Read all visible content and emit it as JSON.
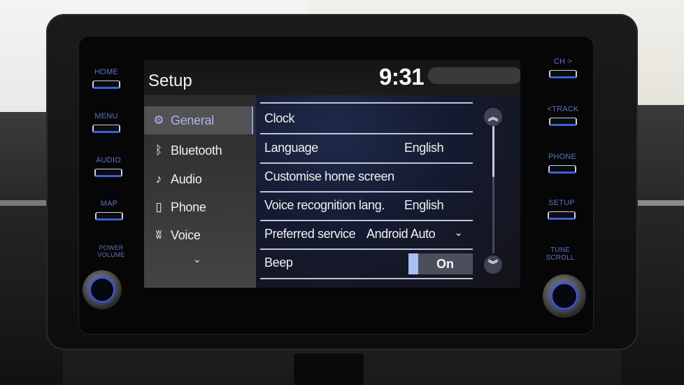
{
  "screen": {
    "title": "Setup",
    "clock": "9:31"
  },
  "hardware_buttons": {
    "left": [
      {
        "label": "HOME"
      },
      {
        "label": "MENU"
      },
      {
        "label": "AUDIO"
      },
      {
        "label": "MAP"
      },
      {
        "label": "POWER VOLUME"
      }
    ],
    "right": [
      {
        "label": "CH >"
      },
      {
        "label": "<TRACK"
      },
      {
        "label": "PHONE"
      },
      {
        "label": "SETUP"
      },
      {
        "label": "TUNE SCROLL"
      }
    ]
  },
  "sidebar": {
    "items": [
      {
        "label": "General",
        "icon": "gear-icon",
        "glyph": "⚙",
        "active": true
      },
      {
        "label": "Bluetooth",
        "icon": "bluetooth-icon",
        "glyph": "ᛒ",
        "active": false
      },
      {
        "label": "Audio",
        "icon": "music-note-icon",
        "glyph": "♪",
        "active": false
      },
      {
        "label": "Phone",
        "icon": "phone-icon",
        "glyph": "▯",
        "active": false
      },
      {
        "label": "Voice",
        "icon": "voice-icon",
        "glyph": "ʬ",
        "active": false
      }
    ],
    "more_glyph": "⌄"
  },
  "settings": {
    "rows": [
      {
        "label": "Clock",
        "value": ""
      },
      {
        "label": "Language",
        "value": "English"
      },
      {
        "label": "Customise home screen",
        "value": ""
      },
      {
        "label": "Voice recognition lang.",
        "value": "English"
      },
      {
        "label": "Preferred service",
        "value": "Android Auto",
        "dropdown_glyph": "⌄"
      },
      {
        "label": "Beep",
        "toggle": "On"
      }
    ]
  },
  "scrollbar": {
    "up_glyph": "︽",
    "down_glyph": "︾",
    "position_fraction": 0.0
  },
  "colors": {
    "accent": "#3a5fd8",
    "active_text": "#aab6ec",
    "toggle_on": "#a8c0f4"
  }
}
